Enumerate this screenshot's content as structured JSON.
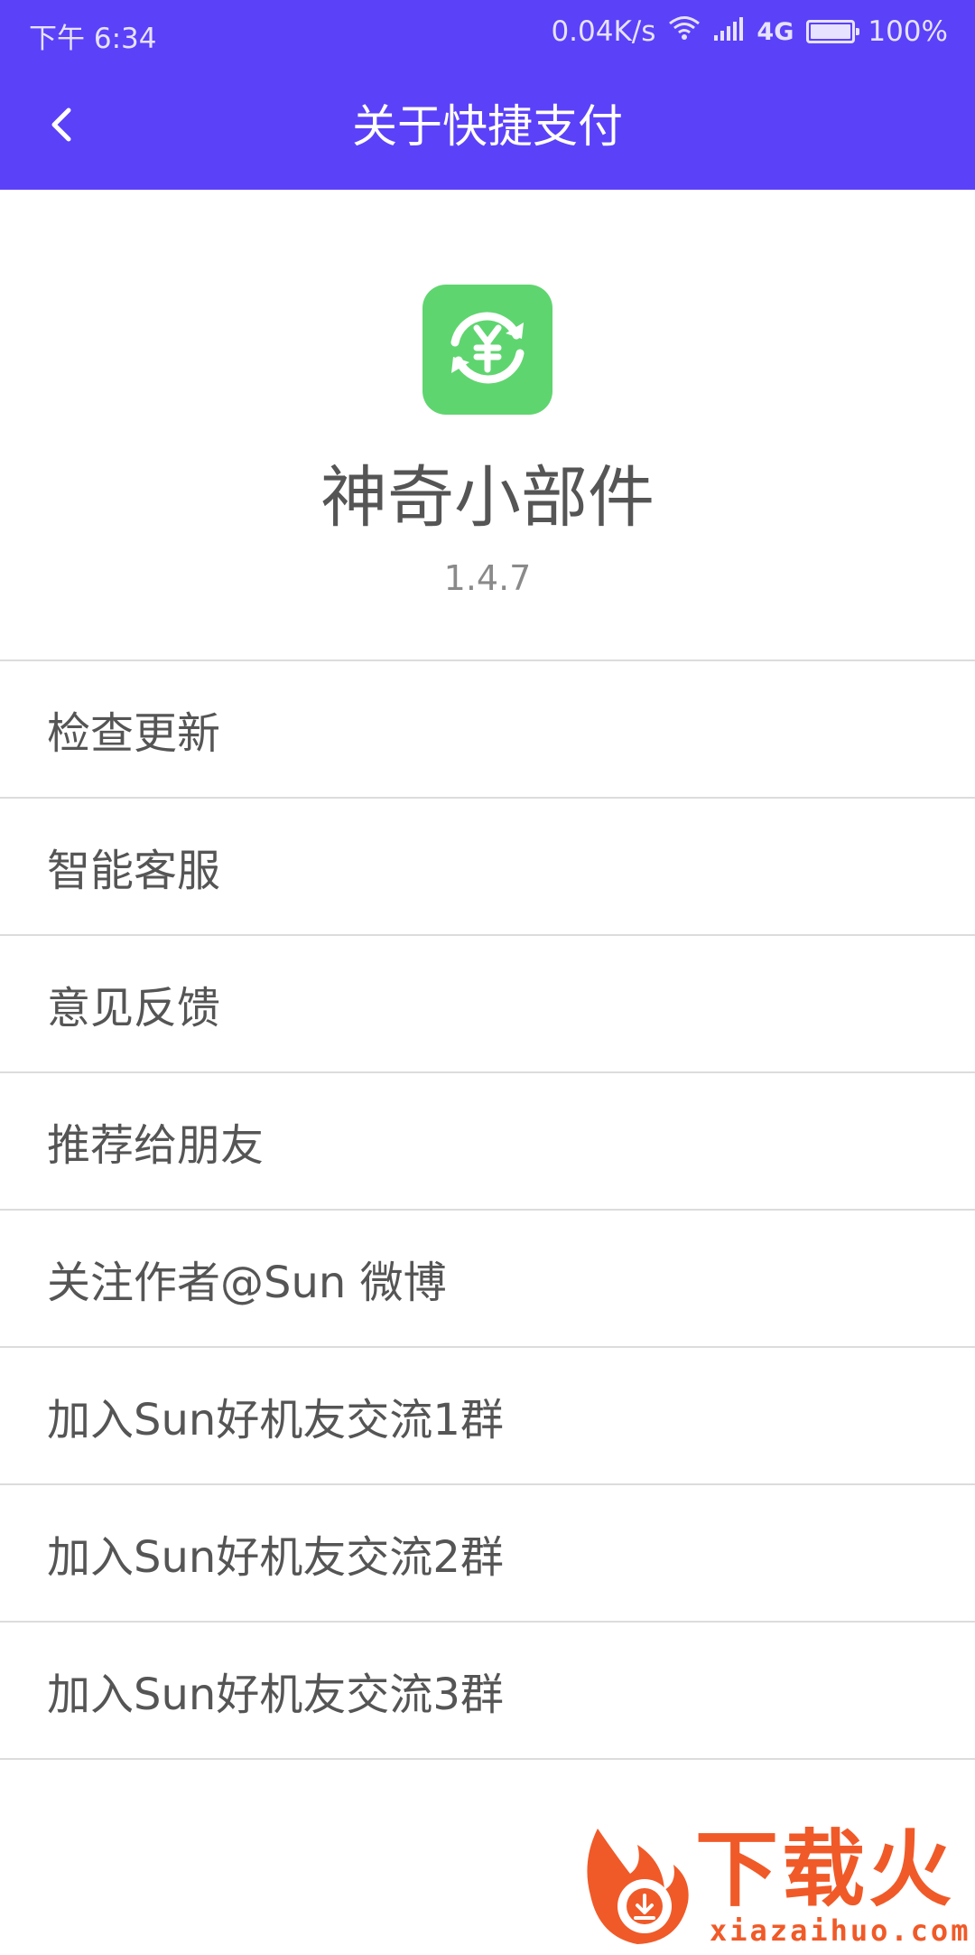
{
  "status_bar": {
    "time": "下午 6:34",
    "speed": "0.04K/s",
    "network": "4G",
    "battery_text": "100%",
    "battery_level": 1.0
  },
  "toolbar": {
    "back_icon": "chevron-left-icon",
    "title": "关于快捷支付"
  },
  "app": {
    "icon": "yen-refresh-icon",
    "name": "神奇小部件",
    "version": "1.4.7"
  },
  "menu": {
    "items": [
      {
        "label": "检查更新"
      },
      {
        "label": "智能客服"
      },
      {
        "label": "意见反馈"
      },
      {
        "label": "推荐给朋友"
      },
      {
        "label": "关注作者@Sun 微博"
      },
      {
        "label": "加入Sun好机友交流1群"
      },
      {
        "label": "加入Sun好机友交流2群"
      },
      {
        "label": "加入Sun好机友交流3群"
      }
    ]
  },
  "watermark": {
    "text": "下载火",
    "url": "xiazaihuo.com"
  },
  "colors": {
    "accent": "#5b41f8",
    "app_icon": "#5fd56f",
    "watermark": "#f05a28"
  }
}
